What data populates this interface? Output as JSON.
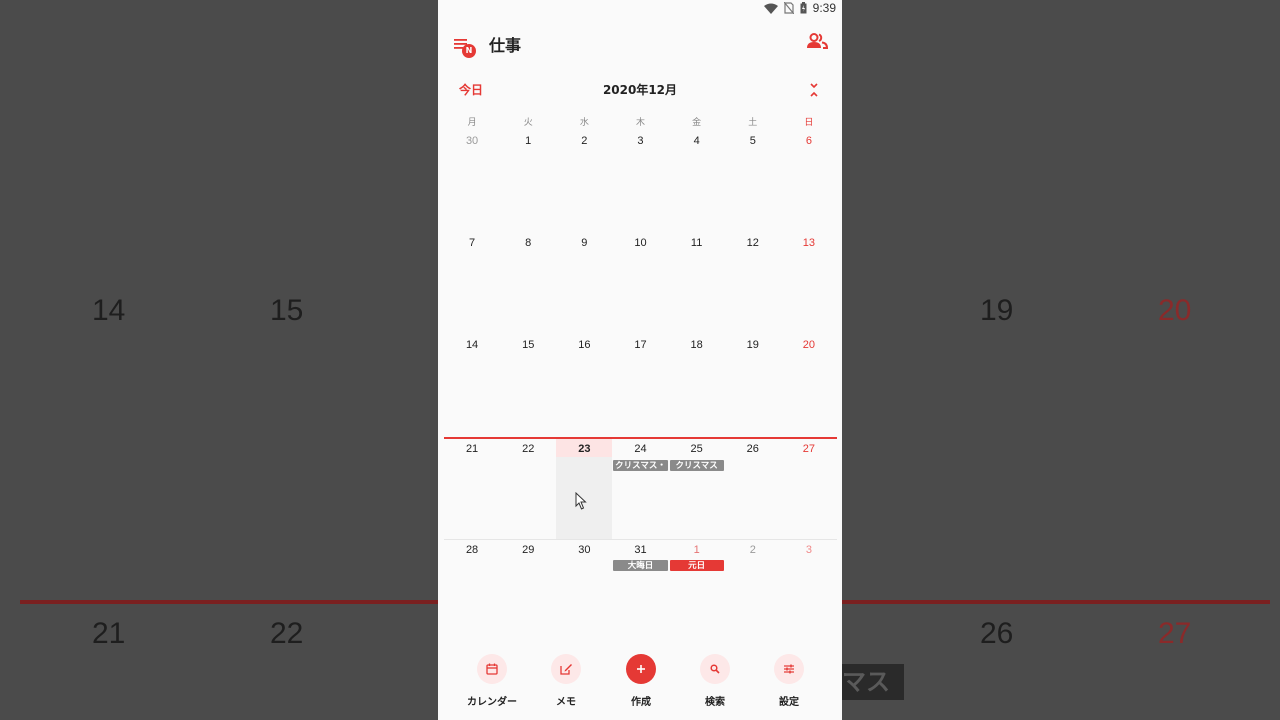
{
  "status_bar": {
    "time": "9:39"
  },
  "app_bar": {
    "title": "仕事",
    "menu_badge": "N"
  },
  "calendar_header": {
    "today_label": "今日",
    "month_title": "2020年12月"
  },
  "weekdays": [
    "月",
    "火",
    "水",
    "木",
    "金",
    "土",
    "日"
  ],
  "weeks": [
    [
      "30",
      "1",
      "2",
      "3",
      "4",
      "5",
      "6"
    ],
    [
      "7",
      "8",
      "9",
      "10",
      "11",
      "12",
      "13"
    ],
    [
      "14",
      "15",
      "16",
      "17",
      "18",
      "19",
      "20"
    ],
    [
      "21",
      "22",
      "23",
      "24",
      "25",
      "26",
      "27"
    ],
    [
      "28",
      "29",
      "30",
      "31",
      "1",
      "2",
      "3"
    ]
  ],
  "events": {
    "christmas_eve": "クリスマス・",
    "christmas": "クリスマス",
    "new_years_eve": "大晦日",
    "new_years_day": "元日"
  },
  "bottom_nav": [
    {
      "label": "カレンダー",
      "icon": "calendar-icon"
    },
    {
      "label": "メモ",
      "icon": "edit-icon"
    },
    {
      "label": "作成",
      "icon": "plus-icon"
    },
    {
      "label": "検索",
      "icon": "search-icon"
    },
    {
      "label": "設定",
      "icon": "settings-sliders-icon"
    }
  ],
  "background": {
    "numbers": [
      "14",
      "15",
      "19",
      "20",
      "21",
      "22",
      "26",
      "27"
    ],
    "chip_text": "マス"
  },
  "colors": {
    "accent": "#e53935",
    "event_gray": "#8a8a8a",
    "today_bg": "#efefef"
  }
}
